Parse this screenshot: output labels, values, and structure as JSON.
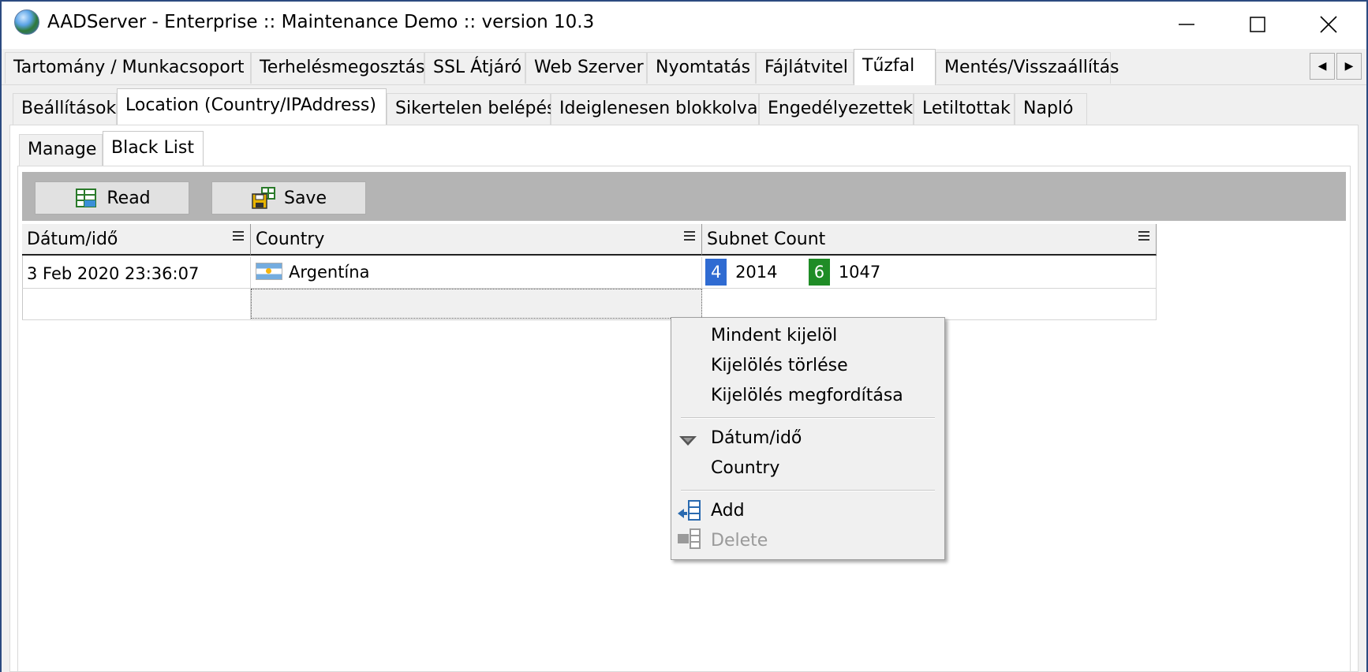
{
  "window": {
    "title": "AADServer - Enterprise :: Maintenance Demo :: version 10.3",
    "controls": [
      "minimize",
      "maximize",
      "close"
    ]
  },
  "tabs_level1": [
    {
      "label": "Tartomány / Munkacsoport"
    },
    {
      "label": "Terhelésmegosztás"
    },
    {
      "label": "SSL Átjáró"
    },
    {
      "label": "Web Szerver"
    },
    {
      "label": "Nyomtatás"
    },
    {
      "label": "Fájlátvitel"
    },
    {
      "label": "Tűzfal",
      "active": true
    },
    {
      "label": "Mentés/Visszaállítás"
    }
  ],
  "tabs_level2": [
    {
      "label": "Beállítások"
    },
    {
      "label": "Location (Country/IPAddress)",
      "active": true
    },
    {
      "label": "Sikertelen belépés"
    },
    {
      "label": "Ideiglenesen blokkolva"
    },
    {
      "label": "Engedélyezettek"
    },
    {
      "label": "Letiltottak"
    },
    {
      "label": "Napló"
    }
  ],
  "tabs_level3": [
    {
      "label": "Manage"
    },
    {
      "label": "Black List",
      "active": true
    }
  ],
  "toolbar": {
    "read_label": "Read",
    "save_label": "Save"
  },
  "grid": {
    "columns": [
      "Dátum/idő",
      "Country",
      "Subnet Count"
    ],
    "rows": [
      {
        "datetime": "3 Feb 2020 23:36:07",
        "country": "Argentína",
        "ipv4_badge": "4",
        "ipv4_count": "2014",
        "ipv6_badge": "6",
        "ipv6_count": "1047"
      }
    ]
  },
  "context_menu": {
    "select_all": "Mindent kijelöl",
    "clear_selection": "Kijelölés törlése",
    "invert_selection": "Kijelölés megfordítása",
    "col_datetime": "Dátum/idő",
    "col_country": "Country",
    "add": "Add",
    "delete": "Delete"
  },
  "colors": {
    "badge_ipv4": "#2f6bd2",
    "badge_ipv6": "#1f8c26",
    "toolbar_bg": "#b4b4b4"
  }
}
